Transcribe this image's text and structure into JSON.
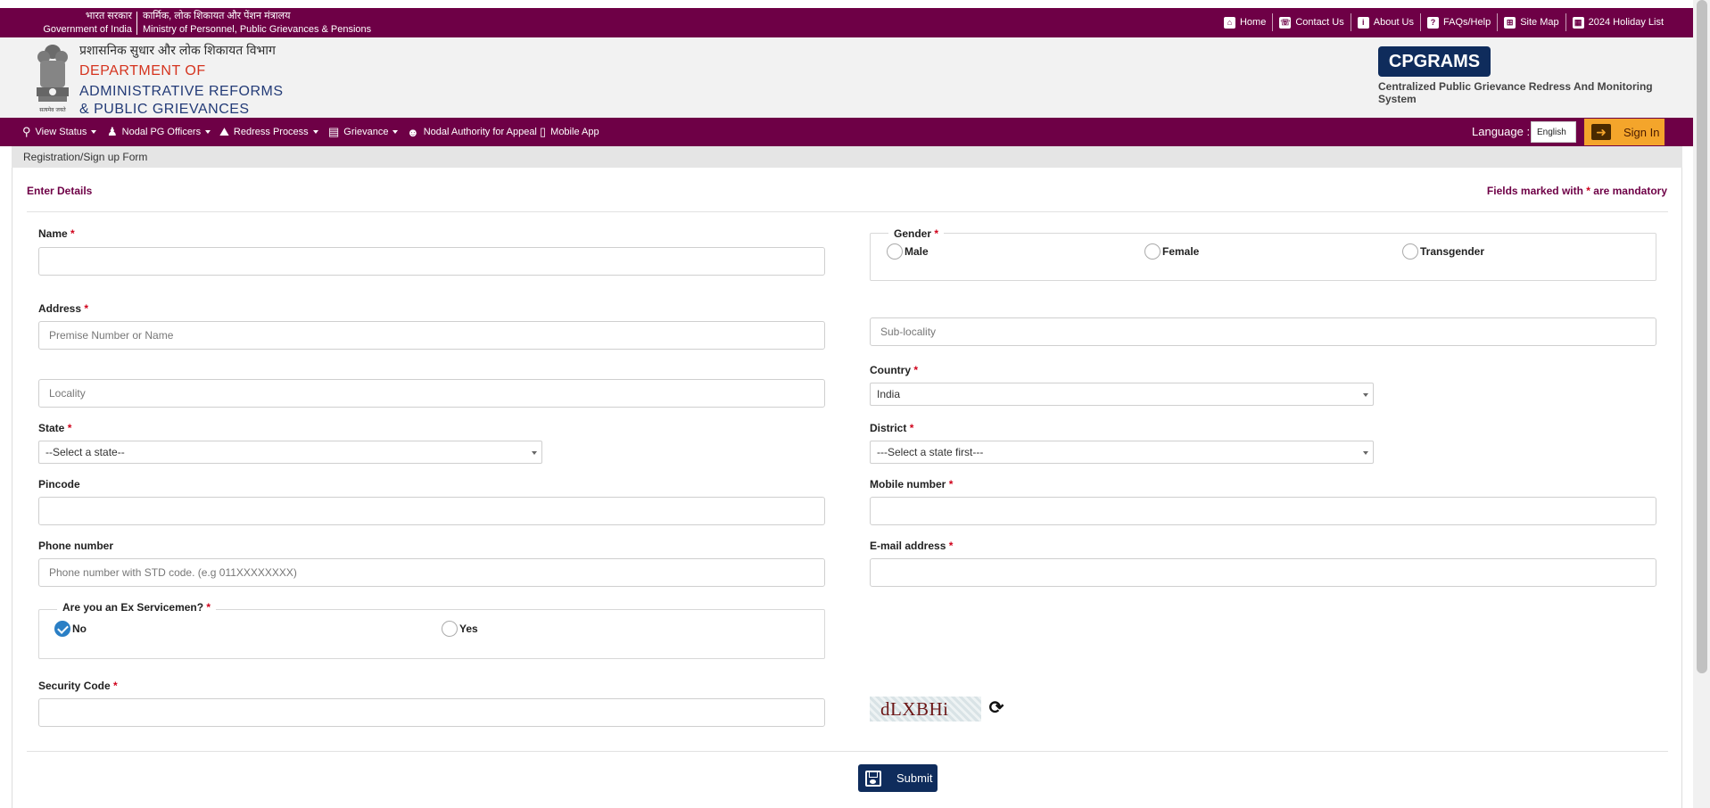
{
  "topbar": {
    "gov_hi": "भारत सरकार",
    "gov_en": "Government of India",
    "ministry_hi": "कार्मिक, लोक शिकायत और पेंशन मंत्रालय",
    "ministry_en": "Ministry of Personnel, Public Grievances & Pensions",
    "links": [
      {
        "label": "Home",
        "icon": "home-icon"
      },
      {
        "label": "Contact Us",
        "icon": "phone-icon"
      },
      {
        "label": "About Us",
        "icon": "info-icon"
      },
      {
        "label": "FAQs/Help",
        "icon": "help-icon"
      },
      {
        "label": "Site Map",
        "icon": "sitemap-icon"
      },
      {
        "label": "2024 Holiday List",
        "icon": "calendar-icon"
      }
    ]
  },
  "header": {
    "emblem_caption": "सत्यमेव जयते",
    "dept_hi": "प्रशासनिक सुधार और लोक शिकायत विभाग",
    "dept_line1": "DEPARTMENT OF",
    "dept_line2": "ADMINISTRATIVE REFORMS",
    "dept_line3": "& PUBLIC GRIEVANCES",
    "brand": "CPGRAMS",
    "brand_sub": "Centralized Public Grievance Redress And Monitoring System"
  },
  "nav": {
    "items": [
      {
        "label": "View Status",
        "icon": "search-icon",
        "dropdown": true
      },
      {
        "label": "Nodal PG Officers",
        "icon": "officer-icon",
        "dropdown": true
      },
      {
        "label": "Redress Process",
        "icon": "road-icon",
        "dropdown": true
      },
      {
        "label": "Grievance",
        "icon": "document-icon",
        "dropdown": true
      },
      {
        "label": "Nodal Authority for Appeal",
        "icon": "users-icon",
        "dropdown": false
      },
      {
        "label": "Mobile App",
        "icon": "mobile-icon",
        "dropdown": false
      }
    ],
    "language_label": "Language :",
    "language_value": "English",
    "signin_label": "Sign In"
  },
  "form": {
    "breadcrumb": "Registration/Sign up Form",
    "section_title": "Enter Details",
    "mandatory_note_pre": "Fields marked with ",
    "mandatory_star": "*",
    "mandatory_note_post": " are mandatory",
    "name_label": "Name",
    "gender_label": "Gender",
    "gender_options": [
      "Male",
      "Female",
      "Transgender"
    ],
    "address_label": "Address",
    "premise_placeholder": "Premise Number or Name",
    "sublocality_placeholder": "Sub-locality",
    "locality_placeholder": "Locality",
    "country_label": "Country",
    "country_value": "India",
    "state_label": "State",
    "state_value": "--Select a state--",
    "district_label": "District",
    "district_value": "---Select a state first---",
    "pincode_label": "Pincode",
    "mobile_label": "Mobile number",
    "phone_label": "Phone number",
    "phone_placeholder": "Phone number with STD code. (e.g 011XXXXXXXX)",
    "email_label": "E-mail address",
    "ex_service_label": "Are you an Ex Servicemen?",
    "ex_service_options": [
      {
        "label": "No",
        "checked": true
      },
      {
        "label": "Yes",
        "checked": false
      }
    ],
    "security_label": "Security Code",
    "captcha_text": "dLXBHi",
    "submit_label": "Submit",
    "required_star": "*"
  },
  "colors": {
    "brand_maroon": "#6e0046",
    "navy": "#0f2c5c",
    "signin_orange": "#f4a52b",
    "required_red": "#d0021b",
    "radio_checked": "#2a7fc5"
  }
}
